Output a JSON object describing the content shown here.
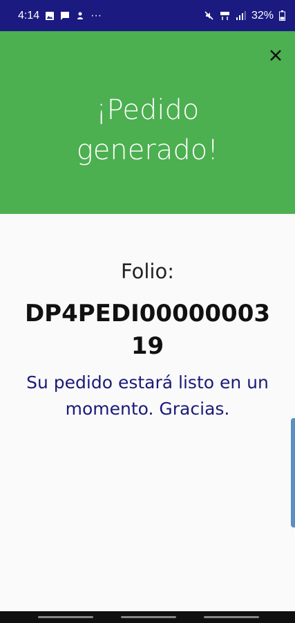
{
  "status_bar": {
    "time": "4:14",
    "overflow": "···",
    "battery": "32%",
    "icons_left": [
      "image-icon",
      "message-icon",
      "notification-icon"
    ],
    "icons_right": [
      "mute-icon",
      "lte-icon",
      "signal-icon",
      "battery-icon"
    ]
  },
  "header": {
    "title_line1": "¡Pedido",
    "title_line2": "generado!",
    "close_icon": "close-icon",
    "background": "#4caf50"
  },
  "content": {
    "folio_label": "Folio:",
    "folio_value": "DP4PEDI0000000319",
    "message": "Su pedido estará listo en un momento. Gracias."
  },
  "colors": {
    "status_bar": "#1a1a80",
    "message_text": "#1a1a7a",
    "background": "#fafafa"
  }
}
